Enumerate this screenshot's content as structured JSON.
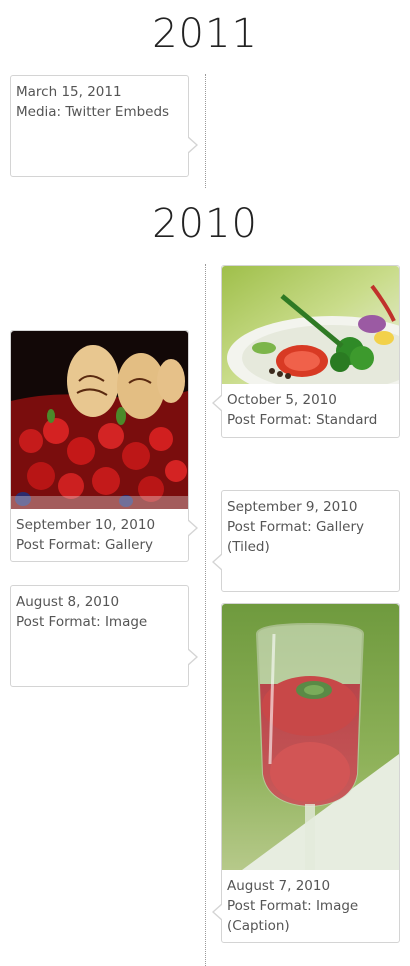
{
  "years": [
    {
      "label": "2011"
    },
    {
      "label": "2010"
    }
  ],
  "posts": [
    {
      "date": "March 15, 2011",
      "title": "Media: Twitter Embeds"
    },
    {
      "date": "October 5, 2010",
      "title": "Post Format: Standard"
    },
    {
      "date": "September 10, 2010",
      "title": "Post Format: Gallery"
    },
    {
      "date": "September 9, 2010",
      "title": "Post Format: Gallery (Tiled)"
    },
    {
      "date": "August 8, 2010",
      "title": "Post Format: Image"
    },
    {
      "date": "August 7, 2010",
      "title": "Post Format: Image (Caption)"
    }
  ],
  "images": {
    "salad": "salad-plate-photo",
    "cake": "strawberry-wedding-cake-photo",
    "glass": "champagne-glass-dessert-photo"
  },
  "colors": {
    "line": "#9a9a9a",
    "card_border": "#d4d4d4",
    "year_text": "#222222",
    "meta_text": "#555555"
  }
}
